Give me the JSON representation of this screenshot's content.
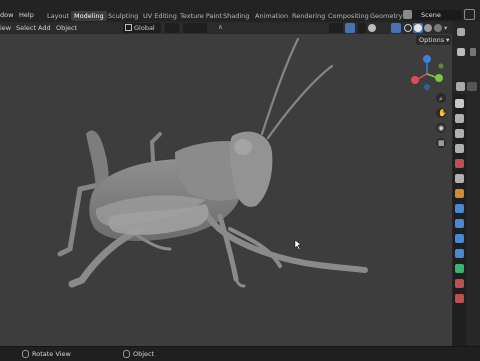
{
  "menu": {
    "window": "dow",
    "help": "Help"
  },
  "workspaces": [
    {
      "label": "Layout"
    },
    {
      "label": "Modeling"
    },
    {
      "label": "Sculpting"
    },
    {
      "label": "UV Editing"
    },
    {
      "label": "Texture Paint"
    },
    {
      "label": "Shading"
    },
    {
      "label": "Animation"
    },
    {
      "label": "Rendering"
    },
    {
      "label": "Compositing"
    },
    {
      "label": "Geometry N"
    }
  ],
  "scene": {
    "label": "Scene"
  },
  "header": {
    "view": "iew",
    "select": "Select",
    "add": "Add",
    "object": "Object",
    "orientation": "Global",
    "options": "Options"
  },
  "gizmo": {
    "x": "X",
    "y": "Y",
    "z": "Z"
  },
  "status": {
    "rotate_view": "Rotate View",
    "object": "Object"
  },
  "colors": {
    "viewport_bg": "#3d3d3d",
    "topbar_bg": "#232323",
    "active_tab": "#3d3d3d",
    "accent_blue": "#4772b3",
    "axis_x": "#e04a5c",
    "axis_y": "#7fc43a",
    "axis_z": "#3f80d8"
  },
  "icons": {
    "blender_logo": "blender-logo-icon",
    "zoom": "zoom-icon",
    "hand": "hand-pan-icon",
    "camera": "camera-icon",
    "grid": "ortho-grid-icon"
  }
}
